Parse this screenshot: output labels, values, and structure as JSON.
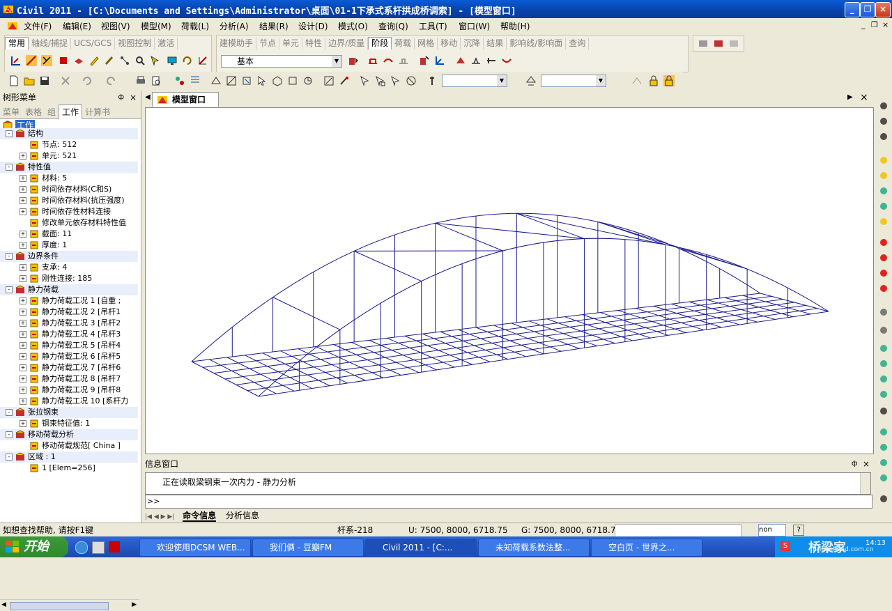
{
  "window": {
    "title": "Civil 2011 - [C:\\Documents and Settings\\Administrator\\桌面\\01-1下承式系杆拱成桥调索] - [模型窗口]",
    "min": "_",
    "max": "❐",
    "close": "×"
  },
  "menu": [
    "文件(F)",
    "编辑(E)",
    "视图(V)",
    "模型(M)",
    "荷载(L)",
    "分析(A)",
    "结果(R)",
    "设计(D)",
    "模式(O)",
    "查询(Q)",
    "工具(T)",
    "窗口(W)",
    "帮助(H)"
  ],
  "tabs1": [
    "常用",
    "轴线/捕捉",
    "UCS/GCS",
    "视图控制",
    "激活"
  ],
  "tabs2": [
    "建模助手",
    "节点",
    "单元",
    "特性",
    "边界/质量",
    "阶段",
    "荷载",
    "网格",
    "移动",
    "沉降",
    "结果",
    "影响线/影响面",
    "查询"
  ],
  "tabs1_active": "常用",
  "tabs2_active": "阶段",
  "combo_basic": "基本",
  "left_panel": {
    "title": "树形菜单",
    "pin": "ф",
    "close": "×",
    "tabs": [
      "菜单",
      "表格",
      "组",
      "工作",
      "计算书"
    ],
    "active_tab": "工作",
    "root": "工作",
    "tree": [
      {
        "label": "结构",
        "level": 0,
        "cat": true,
        "pm": "-"
      },
      {
        "label": "节点: 512",
        "level": 1,
        "pm": ""
      },
      {
        "label": "单元: 521",
        "level": 1,
        "pm": "+"
      },
      {
        "label": "特性值",
        "level": 0,
        "cat": true,
        "pm": "-"
      },
      {
        "label": "材料: 5",
        "level": 1,
        "pm": "+"
      },
      {
        "label": "时间依存材料(C和S)",
        "level": 1,
        "pm": "+"
      },
      {
        "label": "时间依存材料(抗压强度)",
        "level": 1,
        "pm": "+"
      },
      {
        "label": "时间依存性材料连接",
        "level": 1,
        "pm": "+"
      },
      {
        "label": "修改单元依存材料特性值",
        "level": 1,
        "pm": ""
      },
      {
        "label": "截面: 11",
        "level": 1,
        "pm": "+"
      },
      {
        "label": "厚度: 1",
        "level": 1,
        "pm": "+"
      },
      {
        "label": "边界条件",
        "level": 0,
        "cat": true,
        "pm": "-"
      },
      {
        "label": "支承: 4",
        "level": 1,
        "pm": "+"
      },
      {
        "label": "刚性连接: 185",
        "level": 1,
        "pm": "+"
      },
      {
        "label": "静力荷载",
        "level": 0,
        "cat": true,
        "pm": "-"
      },
      {
        "label": "静力荷载工况 1 [自重 ;",
        "level": 1,
        "pm": "+"
      },
      {
        "label": "静力荷载工况 2 [吊杆1",
        "level": 1,
        "pm": "+"
      },
      {
        "label": "静力荷载工况 3 [吊杆2",
        "level": 1,
        "pm": "+"
      },
      {
        "label": "静力荷载工况 4 [吊杆3",
        "level": 1,
        "pm": "+"
      },
      {
        "label": "静力荷载工况 5 [吊杆4",
        "level": 1,
        "pm": "+"
      },
      {
        "label": "静力荷载工况 6 [吊杆5",
        "level": 1,
        "pm": "+"
      },
      {
        "label": "静力荷载工况 7 [吊杆6",
        "level": 1,
        "pm": "+"
      },
      {
        "label": "静力荷载工况 8 [吊杆7",
        "level": 1,
        "pm": "+"
      },
      {
        "label": "静力荷载工况 9 [吊杆8",
        "level": 1,
        "pm": "+"
      },
      {
        "label": "静力荷载工况 10 [系杆力",
        "level": 1,
        "pm": "+"
      },
      {
        "label": "张拉钢束",
        "level": 0,
        "cat": true,
        "pm": "-"
      },
      {
        "label": "钢束特征值: 1",
        "level": 1,
        "pm": "+"
      },
      {
        "label": "移动荷载分析",
        "level": 0,
        "cat": true,
        "pm": "-"
      },
      {
        "label": "移动荷载规范[ China ]",
        "level": 1,
        "pm": ""
      },
      {
        "label": "区域 : 1",
        "level": 0,
        "cat": true,
        "pm": "-"
      },
      {
        "label": "1 [Elem=256]",
        "level": 1,
        "pm": ""
      }
    ]
  },
  "view": {
    "tab_label": "模型窗口",
    "close": "×",
    "prev": "◀",
    "next": "▶"
  },
  "info": {
    "title": "信息窗口",
    "message": "正在读取梁钢束一次内力 - 静力分析",
    "prompt": ">>",
    "tabs": [
      "命令信息",
      "分析信息"
    ],
    "active_tab": "命令信息",
    "pin": "ф",
    "close": "×"
  },
  "status": {
    "help": "如想查找帮助, 请按F1键",
    "sel": "杆系-218",
    "ucs": "U: 7500, 8000, 6718.75",
    "gcs": "G: 7500, 8000, 6718.75",
    "unit": "non"
  },
  "taskbar": {
    "start": "开始",
    "tasks": [
      "欢迎使用DCSM WEB...",
      "我们俩 - 豆瓣FM",
      "Civil 2011 - [C:...",
      "未知荷载系数法整...",
      "空白页 - 世界之..."
    ],
    "active": "Civil 2011 - [C:...",
    "clock": "14:13",
    "watermark": "桥梁家",
    "watermark_url": "Bridgehead.com.cn"
  },
  "colors": {
    "titlebar": "#0a4fc7",
    "model_lines": "#1a1a8c",
    "taskbar": "#245dd5"
  }
}
